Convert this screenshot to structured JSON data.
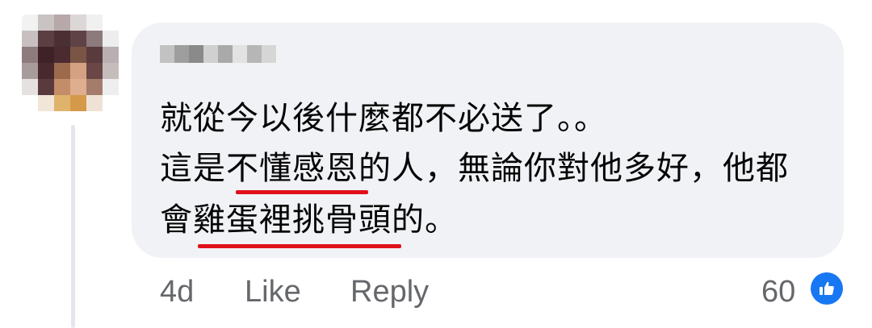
{
  "comment": {
    "author_name": "",
    "text_lines": [
      "就從今以後什麼都不必送了。。",
      "這是不懂感恩的人，無論你對他多好，他都",
      "會雞蛋裡挑骨頭的。"
    ]
  },
  "footer": {
    "timestamp": "4d",
    "like_label": "Like",
    "reply_label": "Reply",
    "reaction_count": "60"
  },
  "colors": {
    "bubble_bg": "#f0f2f5",
    "text": "#050505",
    "secondary_text": "#65676b",
    "like_blue": "#1877f2",
    "highlight_underline": "#e0101a"
  },
  "icons": {
    "reaction": "thumbs-up-icon"
  }
}
